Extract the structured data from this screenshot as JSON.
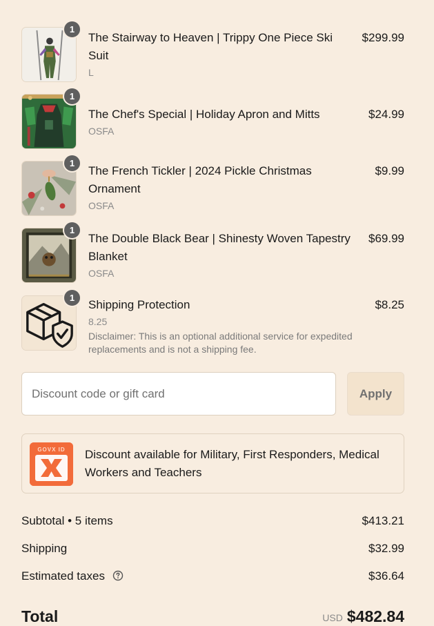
{
  "items": [
    {
      "qty": "1",
      "title": "The Stairway to Heaven | Trippy One Piece Ski Suit",
      "variant": "L",
      "price": "$299.99",
      "icon": "ski-suit-thumbnail"
    },
    {
      "qty": "1",
      "title": "The Chef's Special | Holiday Apron and Mitts",
      "variant": "OSFA",
      "price": "$24.99",
      "icon": "apron-thumbnail"
    },
    {
      "qty": "1",
      "title": "The French Tickler | 2024 Pickle Christmas Ornament",
      "variant": "OSFA",
      "price": "$9.99",
      "icon": "pickle-ornament-thumbnail"
    },
    {
      "qty": "1",
      "title": "The Double Black Bear | Shinesty Woven Tapestry Blanket",
      "variant": "OSFA",
      "price": "$69.99",
      "icon": "blanket-thumbnail"
    },
    {
      "qty": "1",
      "title": "Shipping Protection",
      "variant": "8.25",
      "disclaimer": "Disclaimer: This is an optional additional service for expedited replacements and is not a shipping fee.",
      "price": "$8.25",
      "icon": "package-shield-icon"
    }
  ],
  "discount": {
    "placeholder": "Discount code or gift card",
    "value": "",
    "apply_label": "Apply"
  },
  "govx": {
    "logo_text": "GOVX ID",
    "message": "Discount available for Military, First Responders, Medical Workers and Teachers",
    "color": "#f26b3a"
  },
  "summary": {
    "subtotal_label": "Subtotal • 5 items",
    "subtotal_value": "$413.21",
    "shipping_label": "Shipping",
    "shipping_value": "$32.99",
    "taxes_label": "Estimated taxes",
    "taxes_value": "$36.64",
    "total_label": "Total",
    "currency": "USD",
    "total_value": "$482.84"
  },
  "colors": {
    "background": "#f8ede0",
    "badge": "#5f5f5f",
    "apply_button": "#f3e3cd"
  }
}
